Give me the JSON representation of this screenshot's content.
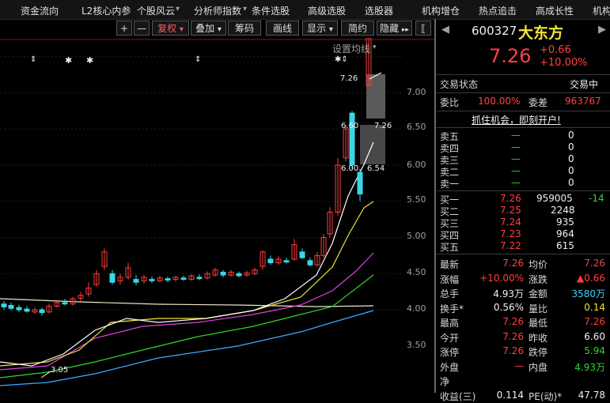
{
  "nav": {
    "items": [
      "资金流向",
      "L2核心内参",
      "个股风云",
      "分析师指数",
      "条件选股",
      "高级选股",
      "选股器",
      "机构增仓",
      "热点追击",
      "高成长性",
      "机构"
    ],
    "dropdown_marks": [
      "▾",
      "▾",
      "▾",
      "▾"
    ]
  },
  "toolbar": {
    "plus": "+",
    "minus": "—",
    "fuquan": "复权",
    "diejia": "叠加",
    "chouma": "筹码",
    "huaxian": "画线",
    "xianshi": "显示",
    "jianyue": "简约",
    "yincang": "隐藏",
    "arrow": "▾",
    "more": "▸▸",
    "collapse": "⟦"
  },
  "chart": {
    "settings_label": "设置均线",
    "price_ticks": [
      "7.00",
      "6.50",
      "6.00",
      "5.50",
      "5.00",
      "4.50",
      "4.00",
      "3.50"
    ],
    "high_label": "7.26",
    "low_label": "3.05",
    "band_labels": [
      "6.60",
      "7.26",
      "6.00",
      "6.54"
    ],
    "markers": [
      "⇕",
      "✱",
      "✱",
      "⇕",
      "✱⇕"
    ],
    "colors": {
      "up": "#ff3b3b",
      "down": "#3ad6e6",
      "ma5": "#ffffff",
      "ma10": "#f2e33a",
      "ma20": "#e040e0",
      "ma30": "#2ed62e",
      "ma60": "#3fa9ff"
    }
  },
  "quote": {
    "code": "600327",
    "name": "大东方",
    "price": "7.26",
    "change": "+0.66",
    "change_pct": "+10.00%",
    "status_label": "交易状态",
    "status_value": "交易中",
    "weibi_label": "委比",
    "weibi_value": "100.00%",
    "weicha_label": "委差",
    "weicha_value": "963767",
    "banner": "抓住机会，即刻开户!",
    "nav_left": "◀",
    "nav_right": "▶"
  },
  "sell": [
    {
      "label": "卖五",
      "price": "—",
      "vol": "0"
    },
    {
      "label": "卖四",
      "price": "—",
      "vol": "0"
    },
    {
      "label": "卖三",
      "price": "—",
      "vol": "0"
    },
    {
      "label": "卖二",
      "price": "—",
      "vol": "0"
    },
    {
      "label": "卖一",
      "price": "—",
      "vol": "0"
    }
  ],
  "buy": [
    {
      "label": "买一",
      "price": "7.26",
      "vol": "959005",
      "delta": "-14"
    },
    {
      "label": "买二",
      "price": "7.25",
      "vol": "2248",
      "delta": ""
    },
    {
      "label": "买三",
      "price": "7.24",
      "vol": "935",
      "delta": ""
    },
    {
      "label": "买四",
      "price": "7.23",
      "vol": "964",
      "delta": ""
    },
    {
      "label": "买五",
      "price": "7.22",
      "vol": "615",
      "delta": ""
    }
  ],
  "stats": [
    {
      "l1": "最新",
      "v1": "7.26",
      "c1": "red",
      "l2": "均价",
      "v2": "7.26",
      "c2": "red"
    },
    {
      "l1": "涨幅",
      "v1": "+10.00%",
      "c1": "red",
      "l2": "涨跌",
      "v2": "▲0.66",
      "c2": "red"
    },
    {
      "l1": "总手",
      "v1": "4.93万",
      "c1": "white",
      "l2": "金额",
      "v2": "3580万",
      "c2": "cyan"
    },
    {
      "l1": "换手*",
      "v1": "0.56%",
      "c1": "white",
      "l2": "量比",
      "v2": "0.14",
      "c2": "yellow"
    },
    {
      "l1": "最高",
      "v1": "7.26",
      "c1": "red",
      "l2": "最低",
      "v2": "7.26",
      "c2": "red"
    },
    {
      "l1": "今开",
      "v1": "7.26",
      "c1": "red",
      "l2": "昨收",
      "v2": "6.60",
      "c2": "white"
    },
    {
      "l1": "涨停",
      "v1": "7.26",
      "c1": "red",
      "l2": "跌停",
      "v2": "5.94",
      "c2": "green"
    },
    {
      "l1": "外盘",
      "v1": "—",
      "c1": "red",
      "l2": "内盘",
      "v2": "4.93万",
      "c2": "green"
    },
    {
      "l1": "净",
      "v1": "",
      "c1": "white",
      "l2": "",
      "v2": "",
      "c2": "white"
    },
    {
      "l1": "收益(三)",
      "v1": "0.114",
      "c1": "white",
      "l2": "PE(动)*",
      "v2": "47.78",
      "c2": "white"
    }
  ]
}
